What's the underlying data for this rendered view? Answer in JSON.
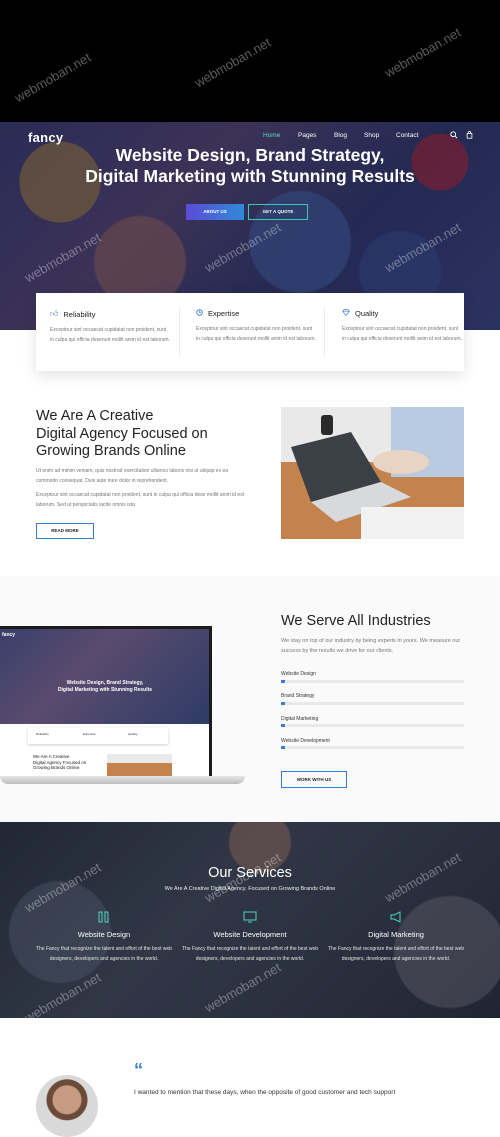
{
  "nav": {
    "logo": "fancy",
    "items": [
      "Home",
      "Pages",
      "Blog",
      "Shop",
      "Contact"
    ],
    "active_index": 0,
    "icons": [
      "search-icon",
      "cart-icon"
    ]
  },
  "hero": {
    "title_line1": "Website Design, Brand Strategy,",
    "title_line2": "Digital Marketing with Stunning Results",
    "btn_about": "ABOUT US",
    "btn_quote": "GET A QUOTE"
  },
  "features": [
    {
      "icon": "thumbs-up-icon",
      "title": "Reliability",
      "text": "Exceptour sint occaecat cupidatat non proident, sunt in culpa qui officia deserunt mollit anim id est laborum."
    },
    {
      "icon": "clock-icon",
      "title": "Expertise",
      "text": "Exceptour sint occaecat cupidatat non proident, sunt in culpa qui officia deserunt mollit anim id est laborum."
    },
    {
      "icon": "diamond-icon",
      "title": "Quality",
      "text": "Exceptour sint occaecat cupidatat non proident, sunt in culpa qui officia deserunt mollit anim id est laborum."
    }
  ],
  "creative": {
    "title_line1": "We Are A Creative",
    "title_line2": "Digital Agency Focused on",
    "title_line3": "Growing Brands Online",
    "para1": "Ut enim ad minim veniam, quis nostrud exercitation ullamco laboris nisi ut aliquip ex ea commodo consequat. Duis aute irure dolor in reprehenderit.",
    "para2": "Exceptour sint occaecat cupidatat non proident, sunt in culpa qui officia dese mollit anim id est laborum. Sed ut perspiciatis iacde omnis ista",
    "btn": "READ MORE"
  },
  "laptop": {
    "logo": "fancy",
    "hero_line1": "Website Design, Brand Strategy,",
    "hero_line2": "Digital Marketing with Stunning Results",
    "features": [
      "Reliability",
      "Expertise",
      "Quality"
    ],
    "title_line1": "We Are A Creative",
    "title_line2": "Digital Agency Focused on",
    "title_line3": "Growing Brands Online"
  },
  "industries": {
    "title": "We Serve All Industries",
    "text": "We stay on top of our industry by being experts in yours. We measure our success by the results we drive for our clients.",
    "skills": [
      {
        "label": "Website Design",
        "value": 0.02
      },
      {
        "label": "Brand Strategy",
        "value": 0.02
      },
      {
        "label": "Digital Marketing",
        "value": 0.02
      },
      {
        "label": "Website Development",
        "value": 0.02
      }
    ],
    "btn": "WORK WITH US"
  },
  "services": {
    "title": "Our Services",
    "subtitle": "We Are A Creative Digital Agency. Focused on Growing Brands Online",
    "items": [
      {
        "icon": "design-tools-icon",
        "title": "Website Design",
        "text": "The Fancy that recognize the talent and effort of the best web designers, developers and agencies in the world."
      },
      {
        "icon": "monitor-icon",
        "title": "Website Development",
        "text": "The Fancy that recognize the talent and effort of the best web designers, developers and agencies in the world."
      },
      {
        "icon": "megaphone-icon",
        "title": "Digital Marketing",
        "text": "The Fancy that recognize the talent and effort of the best web designers, developers and agencies in the world."
      }
    ]
  },
  "testimonial": {
    "quote_mark": "“",
    "text": "I wanted to mention that these days, when the opposite of good customer and tech support"
  },
  "watermark": "webmoban.net",
  "colors": {
    "accent": "#3a7bd5",
    "teal": "#3cc7b0",
    "nav_active": "#5be0c4"
  }
}
